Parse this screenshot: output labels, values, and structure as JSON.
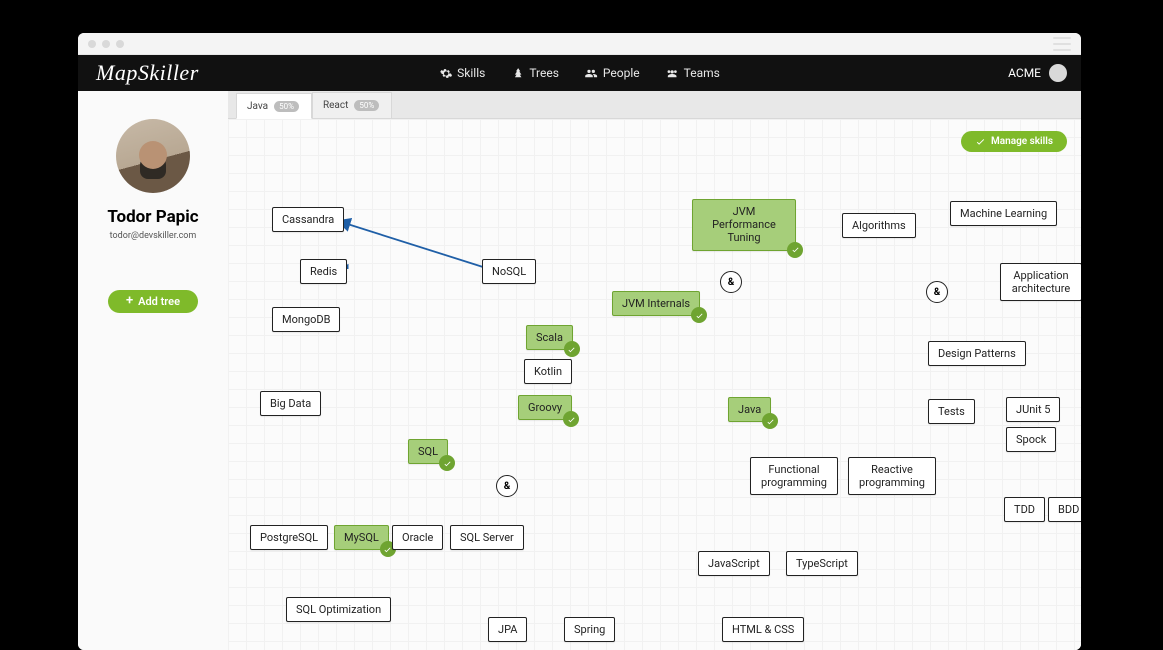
{
  "brand": "MapSkiller",
  "nav": {
    "skills": "Skills",
    "trees": "Trees",
    "people": "People",
    "teams": "Teams"
  },
  "account": {
    "name": "ACME"
  },
  "user": {
    "name": "Todor Papic",
    "email": "todor@devskiller.com"
  },
  "add_tree": "Add tree",
  "tabs": [
    {
      "label": "Java",
      "pct": "50%"
    },
    {
      "label": "React",
      "pct": "50%"
    }
  ],
  "manage_skills": "Manage skills",
  "and_label": "&",
  "nodes": {
    "cassandra": "Cassandra",
    "redis": "Redis",
    "mongodb": "MongoDB",
    "nosql": "NoSQL",
    "bigdata": "Big Data",
    "sql": "SQL",
    "postgres": "PostgreSQL",
    "mysql": "MySQL",
    "oracle": "Oracle",
    "sqlserver": "SQL Server",
    "sqlopt": "SQL Optimization",
    "scala": "Scala",
    "kotlin": "Kotlin",
    "groovy": "Groovy",
    "jvm_internals": "JVM Internals",
    "jvm_perf": "JVM Performance Tuning",
    "java": "Java",
    "jpa": "JPA",
    "spring": "Spring",
    "javascript": "JavaScript",
    "typescript": "TypeScript",
    "htmlcss": "HTML & CSS",
    "functional": "Functional programming",
    "reactive": "Reactive programming",
    "algorithms": "Algorithms",
    "ml": "Machine Learning",
    "apparch": "Application architecture",
    "designpatterns": "Design Patterns",
    "tests": "Tests",
    "junit": "JUnit 5",
    "spock": "Spock",
    "tdd": "TDD",
    "bdd": "BDD"
  }
}
